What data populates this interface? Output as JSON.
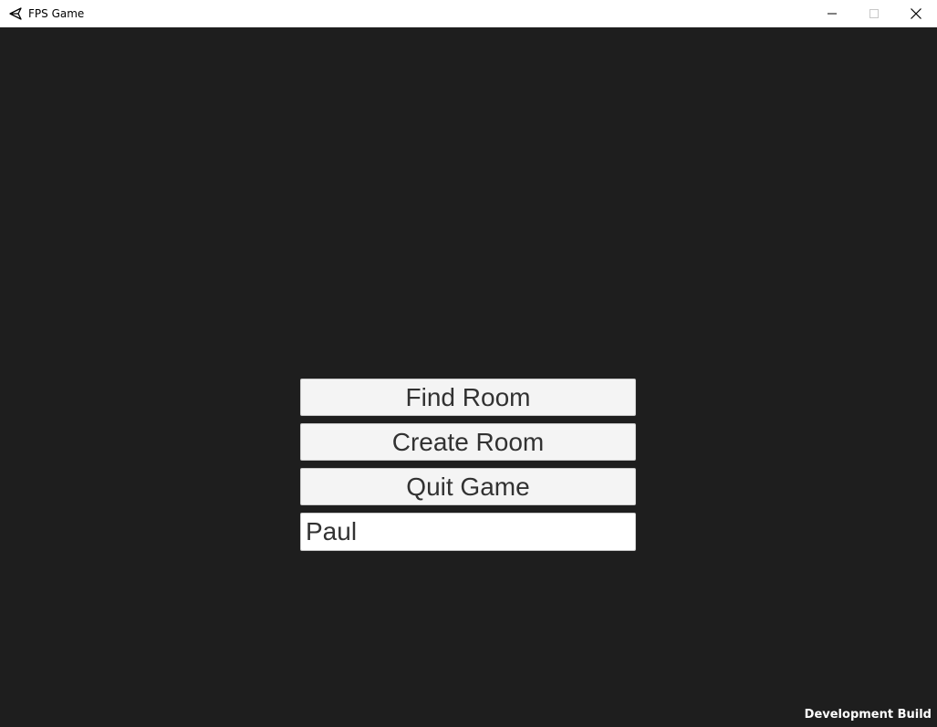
{
  "window": {
    "title": "FPS Game",
    "icon": "unity-logo-icon"
  },
  "controls": {
    "minimize_icon": "minimize-icon",
    "maximize_icon": "maximize-icon",
    "close_icon": "close-icon"
  },
  "menu": {
    "find_room": "Find Room",
    "create_room": "Create Room",
    "quit_game": "Quit Game",
    "player_name": "Paul"
  },
  "footer": {
    "build_label": "Development Build"
  },
  "colors": {
    "background": "#1e1e1e",
    "button_bg": "#f4f4f4",
    "button_text": "#323232",
    "input_bg": "#ffffff"
  }
}
